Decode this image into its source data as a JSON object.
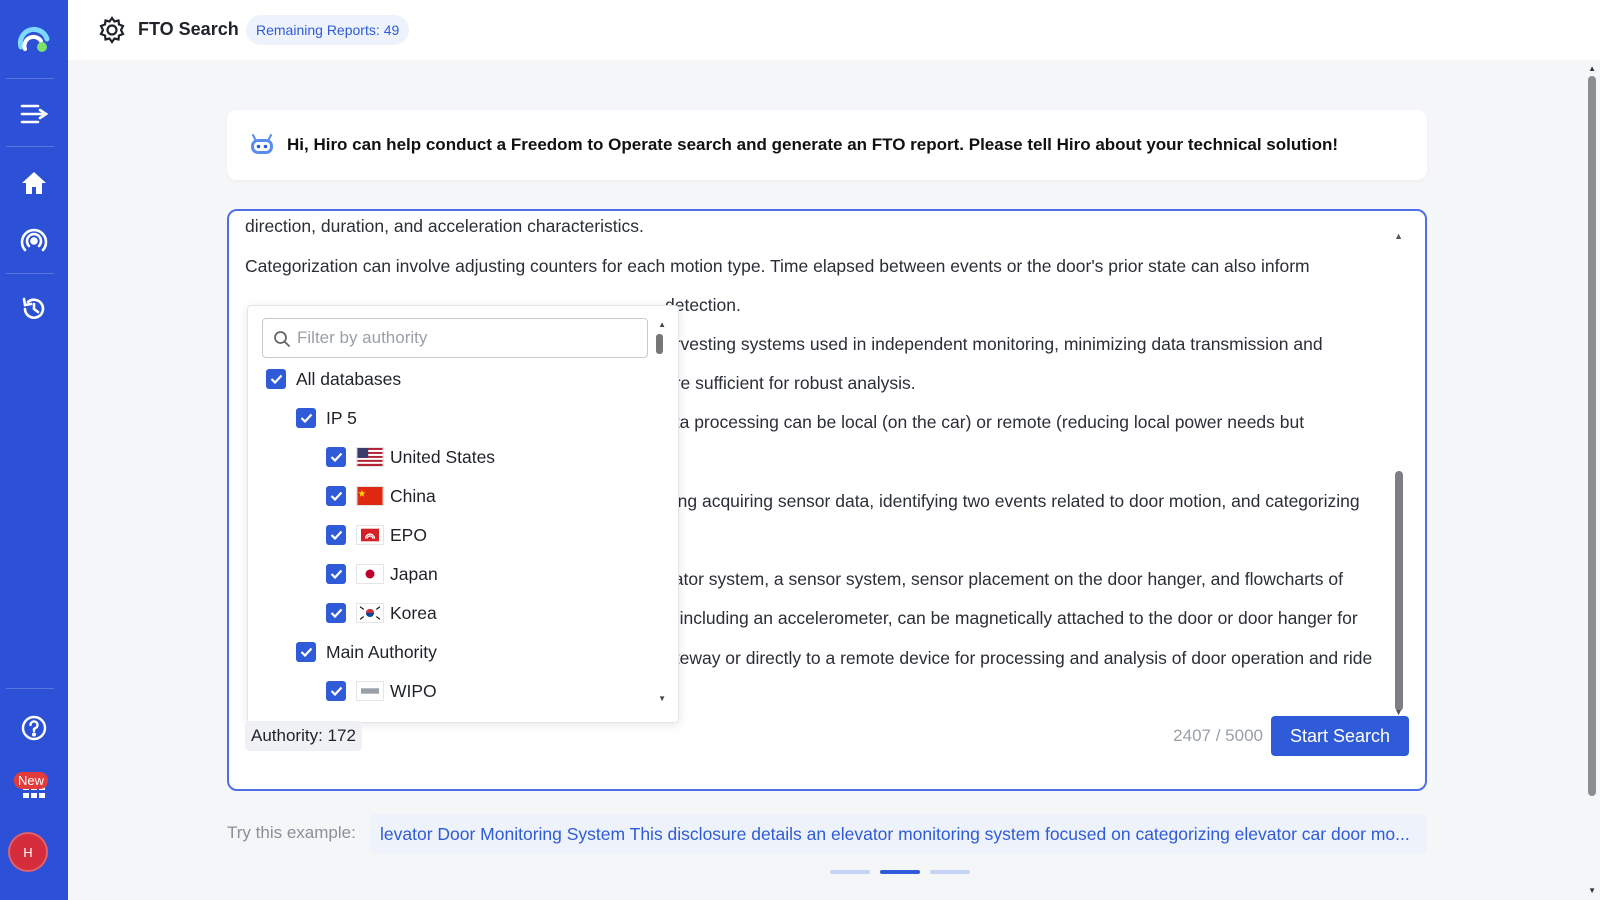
{
  "header": {
    "title": "FTO Search",
    "remaining_label": "Remaining Reports:",
    "remaining_count": "49"
  },
  "sidebar": {
    "items": [
      {
        "icon": "logo-icon"
      },
      {
        "icon": "menu-collapse-icon"
      },
      {
        "icon": "home-icon"
      },
      {
        "icon": "radar-icon"
      },
      {
        "icon": "history-icon"
      },
      {
        "icon": "help-icon"
      },
      {
        "icon": "apps-grid-icon"
      }
    ],
    "new_badge": "New",
    "avatar_initial": "H"
  },
  "intro": {
    "text": "Hi, Hiro can help conduct a Freedom to Operate search and generate an FTO report. Please tell Hiro about your technical solution!"
  },
  "editor": {
    "lines": [
      "direction, duration, and acceleration characteristics.",
      "Categorization can involve adjusting counters for each motion type. Time elapsed between events or the door's prior state can also inform",
      "detection.",
      "arvesting systems used in independent monitoring, minimizing data transmission and",
      "are sufficient for robust analysis.",
      "ata processing can be local (on the car) or remote (reducing local power needs but",
      "ving acquiring sensor data, identifying two events related to door motion, and categorizing",
      "vator system, a sensor system, sensor placement on the door hanger, and flowcharts of",
      "n including an accelerometer, can be magnetically attached to the door or door hanger for",
      "ateway or directly to a remote device for processing and analysis of door operation and ride"
    ],
    "counter_current": "2407",
    "counter_max": "5000",
    "authority_label": "Authority:",
    "authority_count": "172",
    "start_button": "Start Search"
  },
  "dropdown": {
    "filter_placeholder": "Filter by authority",
    "items": [
      {
        "label": "All databases",
        "checked": true,
        "level": 0
      },
      {
        "label": "IP 5",
        "checked": true,
        "level": 1
      },
      {
        "label": "United States",
        "checked": true,
        "level": 2,
        "flag": "us-flag"
      },
      {
        "label": "China",
        "checked": true,
        "level": 2,
        "flag": "cn-flag"
      },
      {
        "label": "EPO",
        "checked": true,
        "level": 2,
        "flag": "epo-flag"
      },
      {
        "label": "Japan",
        "checked": true,
        "level": 2,
        "flag": "jp-flag"
      },
      {
        "label": "Korea",
        "checked": true,
        "level": 2,
        "flag": "kr-flag"
      },
      {
        "label": "Main Authority",
        "checked": true,
        "level": 1
      },
      {
        "label": "WIPO",
        "checked": true,
        "level": 2,
        "flag": "wipo-flag"
      }
    ]
  },
  "example": {
    "label": "Try this example:",
    "text": "levator Door Monitoring System This disclosure details an elevator monitoring system focused on categorizing elevator car door mo..."
  },
  "carousel": {
    "dot_count": 3,
    "active_index": 1
  },
  "colors": {
    "sidebar": "#2c51d6",
    "accent": "#2f5bd8",
    "badge_red": "#e33b3b",
    "avatar_red": "#d62d3d"
  }
}
